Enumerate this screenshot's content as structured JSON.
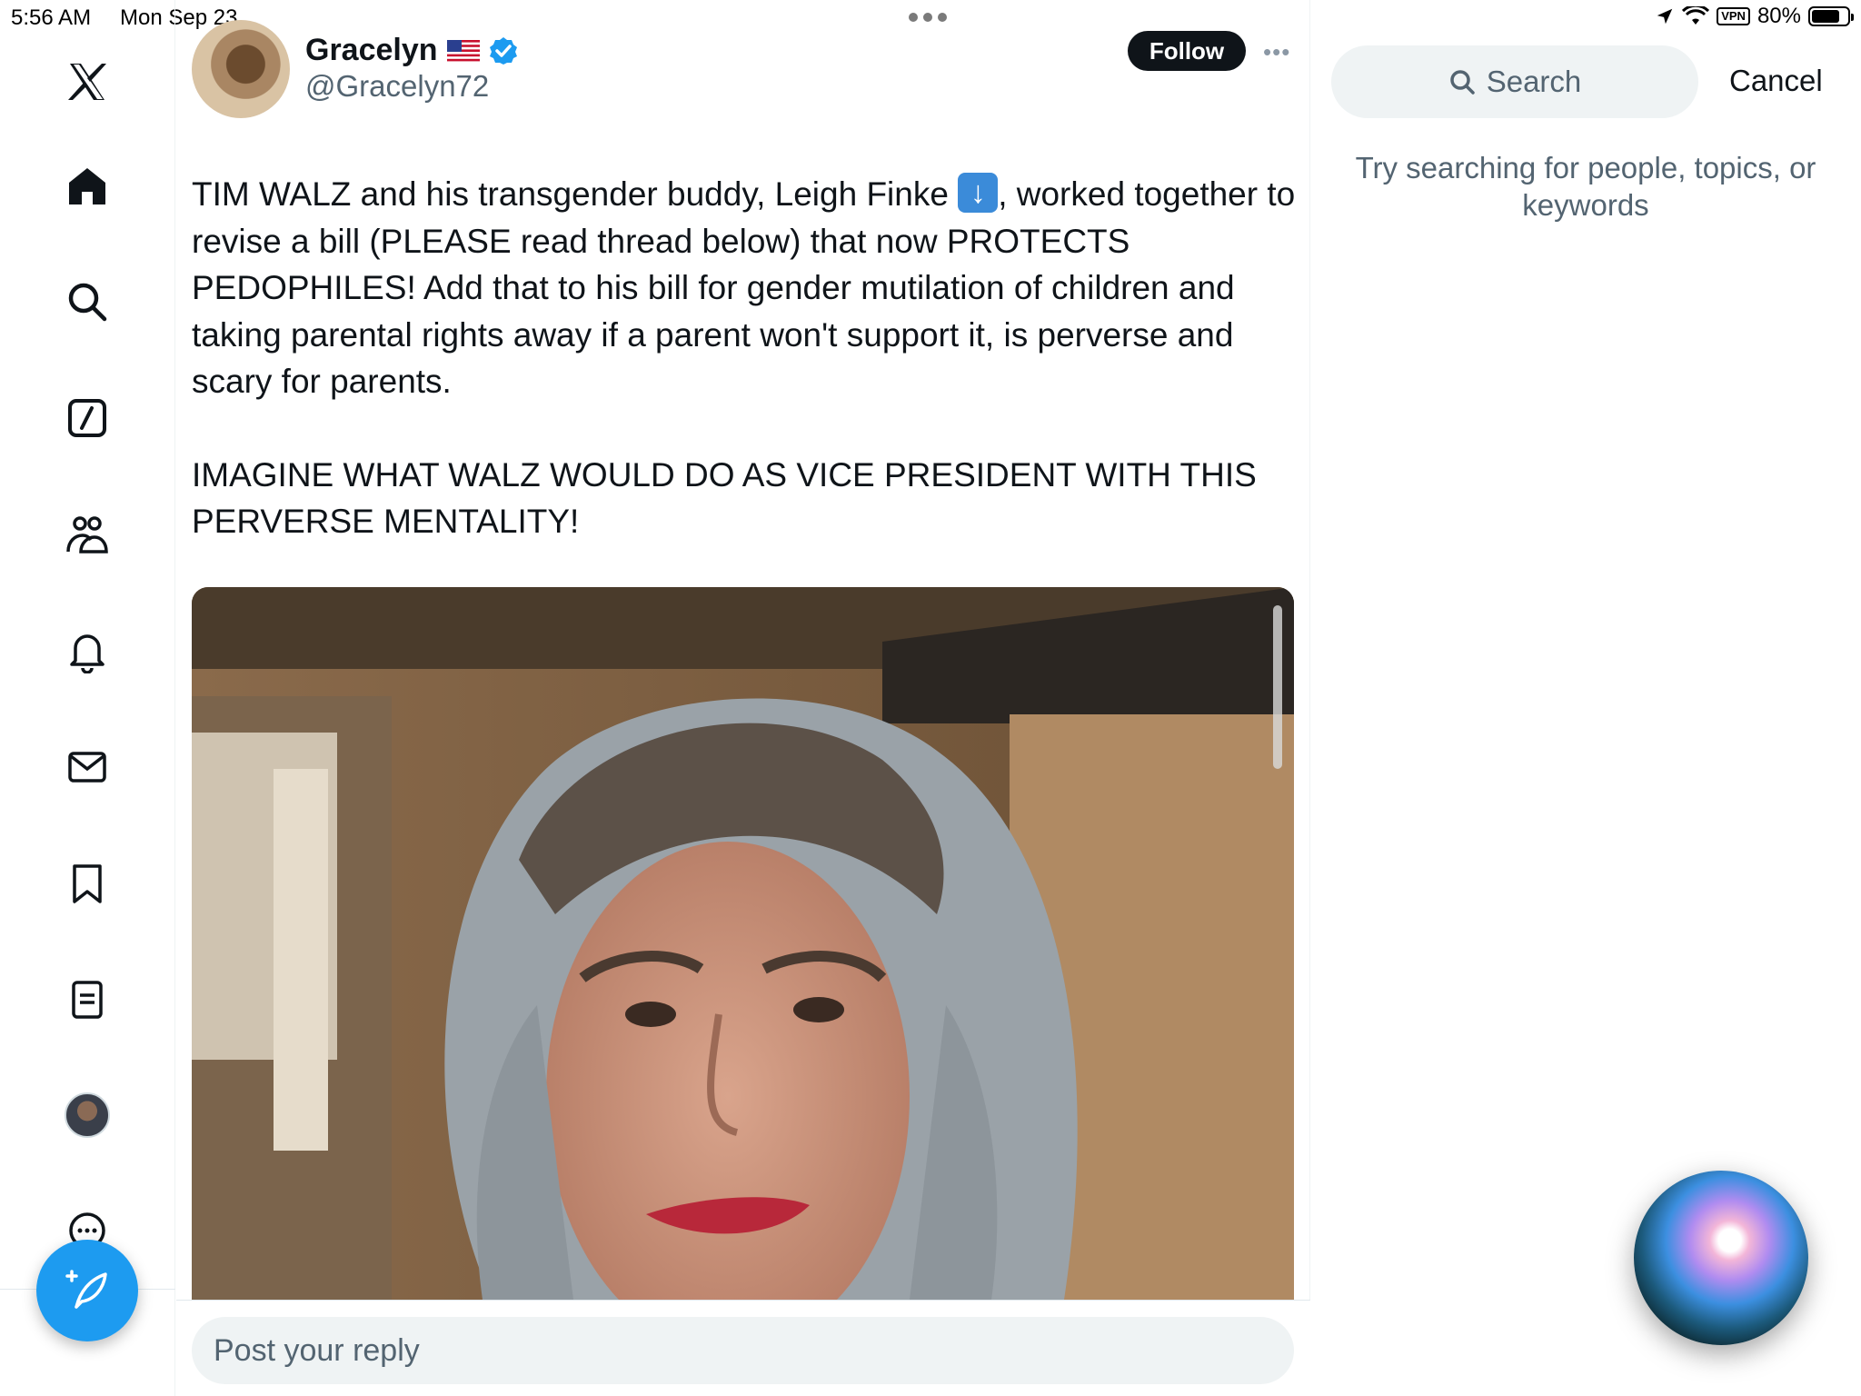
{
  "status_bar": {
    "time": "5:56 AM",
    "date": "Mon Sep 23",
    "vpn": "VPN",
    "battery_percent": "80%",
    "battery_level": 0.8
  },
  "left_nav": {
    "items": [
      {
        "name": "x-logo-icon"
      },
      {
        "name": "home-icon"
      },
      {
        "name": "search-icon"
      },
      {
        "name": "grok-icon"
      },
      {
        "name": "communities-icon"
      },
      {
        "name": "notifications-bell-icon"
      },
      {
        "name": "messages-envelope-icon"
      },
      {
        "name": "bookmark-icon"
      },
      {
        "name": "lists-icon"
      },
      {
        "name": "profile-avatar"
      },
      {
        "name": "more-circle-icon"
      }
    ],
    "compose_icon": "compose-feather-plus-icon"
  },
  "tweet": {
    "display_name": "Gracelyn",
    "handle": "@Gracelyn72",
    "follow_label": "Follow",
    "more_label": "•••",
    "text_paragraph_1a": "TIM WALZ and his transgender buddy, Leigh Finke ",
    "text_paragraph_1b": ", worked together to revise a bill (PLEASE read thread below) that now PROTECTS PEDOPHILES!  Add that to his bill for gender mutilation of children and taking parental rights away if a parent won't support it, is perverse and scary for parents.",
    "text_paragraph_2": "IMAGINE WHAT WALZ WOULD DO AS VICE PRESIDENT WITH THIS PERVERSE MENTALITY!",
    "emoji": "down-arrow-emoji"
  },
  "reply": {
    "placeholder": "Post your reply"
  },
  "search_panel": {
    "search_label": "Search",
    "cancel_label": "Cancel",
    "hint": "Try searching for people, topics, or keywords"
  },
  "colors": {
    "accent": "#1d9bf0",
    "text_primary": "#0f1419",
    "text_secondary": "#536471",
    "input_bg": "#eff3f4"
  }
}
